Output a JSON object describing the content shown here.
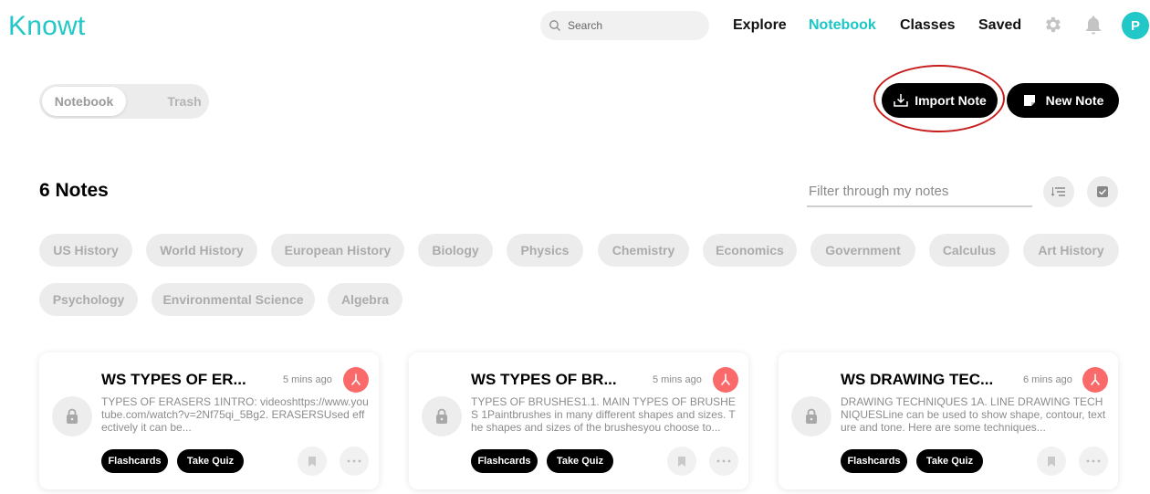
{
  "header": {
    "logo": "Knowt",
    "search_placeholder": "Search",
    "nav": [
      "Explore",
      "Notebook",
      "Classes",
      "Saved"
    ],
    "active_nav": "Notebook",
    "avatar_letter": "P",
    "accent": "#22c7c7"
  },
  "toolbar": {
    "segment": [
      "Notebook",
      "Trash"
    ],
    "import_label": "Import Note",
    "new_label": "New Note"
  },
  "notes": {
    "count_label": "6 Notes",
    "filter_placeholder": "Filter through my notes"
  },
  "subjects": [
    "US History",
    "World History",
    "European History",
    "Biology",
    "Physics",
    "Chemistry",
    "Economics",
    "Government",
    "Calculus",
    "Art History",
    "Psychology",
    "Environmental Science",
    "Algebra"
  ],
  "cards": [
    {
      "title": "WS TYPES OF ER...",
      "time": "5 mins ago",
      "desc": "TYPES OF ERASERS 1INTRO: videoshttps://www.youtube.com/watch?v=2Nf75qi_5Bg2. ERASERSUsed effectively it can be...",
      "flashcards": "Flashcards",
      "quiz": "Take Quiz"
    },
    {
      "title": "WS TYPES OF BR...",
      "time": "5 mins ago",
      "desc": "TYPES OF BRUSHES1.1. MAIN TYPES OF BRUSHES 1Paintbrushes in many different shapes and sizes. The shapes and sizes of the brushesyou choose to...",
      "flashcards": "Flashcards",
      "quiz": "Take Quiz"
    },
    {
      "title": "WS DRAWING TEC...",
      "time": "6 mins ago",
      "desc": "DRAWING TECHNIQUES 1A. LINE DRAWING TECHNIQUESLine can be used to show shape, contour, texture and tone. Here are some techniques...",
      "flashcards": "Flashcards",
      "quiz": "Take Quiz"
    }
  ]
}
